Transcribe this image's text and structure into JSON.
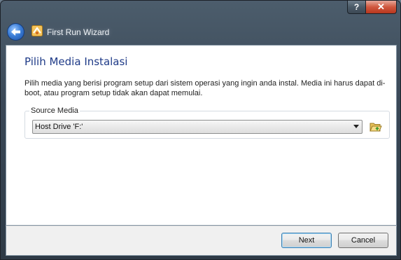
{
  "window": {
    "title": "First Run Wizard",
    "help_label": "?",
    "close_label": "✕"
  },
  "page": {
    "heading": "Pilih Media Instalasi",
    "description": "Pilih media yang berisi program setup dari sistem operasi yang ingin anda instal. Media ini harus dapat di-boot, atau program setup tidak akan dapat memulai."
  },
  "source_media": {
    "legend": "Source Media",
    "selected": "Host Drive 'F:'"
  },
  "buttons": {
    "next": "Next",
    "cancel": "Cancel"
  },
  "icons": {
    "back": "back-arrow-icon",
    "app": "virtualbox-wizard-icon",
    "folder": "open-folder-icon"
  }
}
